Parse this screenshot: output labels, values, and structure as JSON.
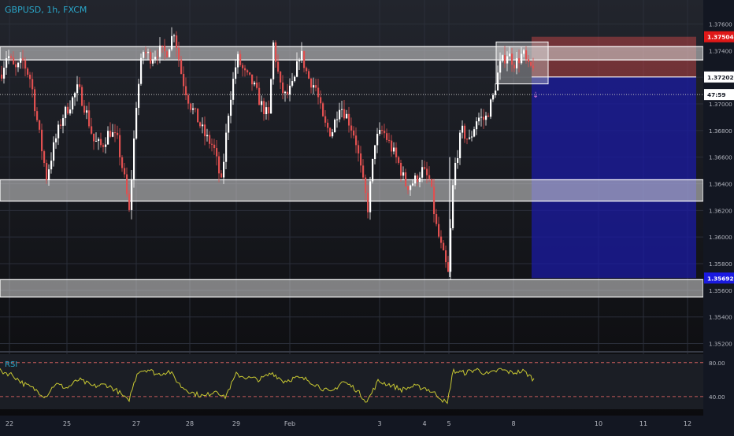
{
  "header": {
    "symbol_label": "GBPUSD, 1h, FXCM"
  },
  "rsi": {
    "label": "RSI",
    "levels": [
      "80.00",
      "40.00"
    ]
  },
  "price_axis": {
    "ticks": [
      "1.37600",
      "1.37400",
      "1.37200",
      "1.37000",
      "1.36800",
      "1.36600",
      "1.36400",
      "1.36200",
      "1.36000",
      "1.35800",
      "1.35600",
      "1.35400",
      "1.35200"
    ],
    "stop_tag": "1.37504",
    "current_tag": "1.37202",
    "timer_tag": "47:59",
    "target_tag": "1.35692"
  },
  "time_axis": {
    "ticks": [
      "22",
      "25",
      "27",
      "28",
      "29",
      "Feb",
      "3",
      "4",
      "5",
      "8",
      "10",
      "11",
      "12"
    ]
  },
  "colors": {
    "background": "#131722",
    "bull": "#ffffff",
    "bear": "#e05050",
    "zone": "#d8d8d8",
    "stop": "#ff0000",
    "target": "#1a1ad0",
    "rsi_line": "#c8c832",
    "rsi_level": "#c75b5b"
  },
  "chart_data": {
    "type": "candlestick",
    "title": "GBPUSD, 1h, FXCM",
    "ylim": [
      1.3515,
      1.3765
    ],
    "zones": [
      {
        "from": 1.3733,
        "to": 1.3743
      },
      {
        "from": 1.3627,
        "to": 1.3643
      },
      {
        "from": 1.3555,
        "to": 1.3568
      }
    ],
    "position": {
      "entry": 1.37202,
      "stop": 1.37504,
      "target": 1.35692
    },
    "price_path": [
      [
        0,
        1.3722
      ],
      [
        8,
        1.3738
      ],
      [
        18,
        1.3725
      ],
      [
        28,
        1.3732
      ],
      [
        38,
        1.3718
      ],
      [
        48,
        1.368
      ],
      [
        58,
        1.3645
      ],
      [
        68,
        1.367
      ],
      [
        78,
        1.369
      ],
      [
        88,
        1.37
      ],
      [
        98,
        1.3712
      ],
      [
        108,
        1.3695
      ],
      [
        118,
        1.3672
      ],
      [
        128,
        1.3668
      ],
      [
        138,
        1.368
      ],
      [
        148,
        1.3672
      ],
      [
        158,
        1.364
      ],
      [
        163,
        1.3618
      ],
      [
        172,
        1.37
      ],
      [
        180,
        1.374
      ],
      [
        190,
        1.3735
      ],
      [
        200,
        1.374
      ],
      [
        210,
        1.3738
      ],
      [
        220,
        1.3755
      ],
      [
        230,
        1.372
      ],
      [
        240,
        1.37
      ],
      [
        250,
        1.3688
      ],
      [
        260,
        1.3675
      ],
      [
        270,
        1.3668
      ],
      [
        280,
        1.364
      ],
      [
        290,
        1.37
      ],
      [
        300,
        1.3735
      ],
      [
        310,
        1.3722
      ],
      [
        320,
        1.3715
      ],
      [
        330,
        1.37
      ],
      [
        340,
        1.369
      ],
      [
        346,
        1.3745
      ],
      [
        355,
        1.3712
      ],
      [
        362,
        1.3705
      ],
      [
        372,
        1.3715
      ],
      [
        380,
        1.374
      ],
      [
        390,
        1.372
      ],
      [
        400,
        1.3712
      ],
      [
        410,
        1.3685
      ],
      [
        420,
        1.3678
      ],
      [
        430,
        1.37
      ],
      [
        440,
        1.369
      ],
      [
        450,
        1.3675
      ],
      [
        460,
        1.364
      ],
      [
        466,
        1.3622
      ],
      [
        475,
        1.3672
      ],
      [
        485,
        1.368
      ],
      [
        495,
        1.3668
      ],
      [
        505,
        1.3655
      ],
      [
        515,
        1.3638
      ],
      [
        525,
        1.3642
      ],
      [
        535,
        1.365
      ],
      [
        545,
        1.3642
      ],
      [
        552,
        1.361
      ],
      [
        560,
        1.359
      ],
      [
        568,
        1.3572
      ],
      [
        575,
        1.3648
      ],
      [
        585,
        1.368
      ],
      [
        595,
        1.3672
      ],
      [
        605,
        1.369
      ],
      [
        615,
        1.3688
      ],
      [
        625,
        1.3705
      ],
      [
        633,
        1.3728
      ],
      [
        643,
        1.3738
      ],
      [
        653,
        1.373
      ],
      [
        663,
        1.3738
      ],
      [
        671,
        1.3725
      ],
      [
        678,
        1.3732
      ]
    ],
    "rsi_ylim": [
      25,
      90
    ],
    "rsi_levels": [
      80,
      40
    ],
    "rsi_path": [
      [
        0,
        70
      ],
      [
        15,
        66
      ],
      [
        30,
        55
      ],
      [
        45,
        48
      ],
      [
        58,
        40
      ],
      [
        70,
        55
      ],
      [
        85,
        50
      ],
      [
        100,
        60
      ],
      [
        118,
        52
      ],
      [
        135,
        54
      ],
      [
        150,
        46
      ],
      [
        163,
        34
      ],
      [
        175,
        70
      ],
      [
        188,
        72
      ],
      [
        200,
        66
      ],
      [
        215,
        70
      ],
      [
        230,
        52
      ],
      [
        245,
        44
      ],
      [
        260,
        40
      ],
      [
        275,
        48
      ],
      [
        285,
        38
      ],
      [
        300,
        66
      ],
      [
        315,
        62
      ],
      [
        330,
        60
      ],
      [
        346,
        68
      ],
      [
        360,
        58
      ],
      [
        375,
        62
      ],
      [
        390,
        60
      ],
      [
        405,
        52
      ],
      [
        420,
        44
      ],
      [
        435,
        58
      ],
      [
        450,
        50
      ],
      [
        466,
        34
      ],
      [
        480,
        58
      ],
      [
        495,
        54
      ],
      [
        510,
        48
      ],
      [
        525,
        52
      ],
      [
        540,
        50
      ],
      [
        555,
        42
      ],
      [
        568,
        31
      ],
      [
        575,
        70
      ],
      [
        590,
        68
      ],
      [
        605,
        72
      ],
      [
        620,
        66
      ],
      [
        635,
        72
      ],
      [
        650,
        68
      ],
      [
        665,
        70
      ],
      [
        678,
        60
      ]
    ]
  }
}
